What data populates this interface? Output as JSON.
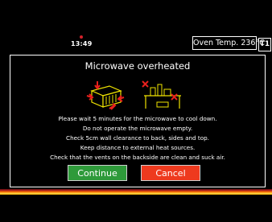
{
  "status": {
    "time": "13:49"
  },
  "oven_temp": {
    "label": "Oven Temp. 236°C"
  },
  "mode_badge": "T1",
  "dialog": {
    "title": "Microwave overheated",
    "messages": [
      "Please wait 5 minutes for the microwave to cool down.",
      "Do not operate the microwave empty.",
      "Check 5cm wall clearance to back, sides and top.",
      "Keep distance to external heat sources.",
      "Check that the vents on the backside are clean and suck air."
    ],
    "continue_label": "Continue",
    "cancel_label": "Cancel"
  },
  "colors": {
    "continue_button": "#2e9a3a",
    "cancel_button": "#ee3a1e",
    "status_dot": "#d3212a"
  },
  "icons": [
    "microwave-vents-icon",
    "no-objects-on-top-icon"
  ]
}
